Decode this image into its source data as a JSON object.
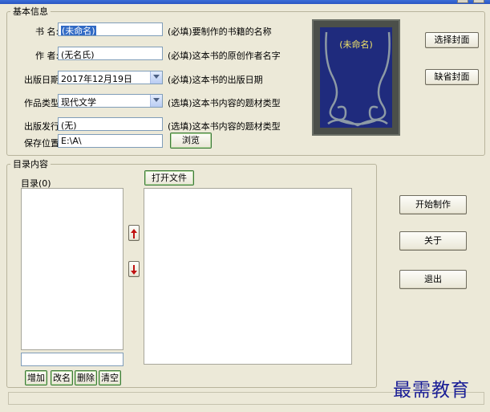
{
  "basic": {
    "group_title": "基本信息",
    "book_name_label": "书  名:",
    "book_name_value": "(未命名)",
    "book_name_hint": "(必填)要制作的书籍的名称",
    "author_label": "作  者:",
    "author_value": "(无名氏)",
    "author_hint": "(必填)这本书的原创作者名字",
    "date_label": "出版日期:",
    "date_value": "2017年12月19日",
    "date_hint": "(必填)这本书的出版日期",
    "genre_label": "作品类型:",
    "genre_value": "现代文学",
    "genre_hint": "(选填)这本书内容的题材类型",
    "publisher_label": "出版发行:",
    "publisher_value": "(无)",
    "publisher_hint": "(选填)这本书内容的题材类型",
    "save_label": "保存位置:",
    "save_value": "E:\\A\\",
    "browse_button": "浏览",
    "cover_title": "(未命名)",
    "choose_cover_button": "选择封面",
    "default_cover_button": "缺省封面"
  },
  "toc": {
    "group_title": "目录内容",
    "list_label": "目录(0)",
    "open_file_button": "打开文件",
    "add_button": "增加",
    "rename_button": "改名",
    "delete_button": "删除",
    "clear_button": "清空"
  },
  "actions": {
    "start_button": "开始制作",
    "about_button": "关于",
    "exit_button": "退出"
  },
  "watermark": "最需教育",
  "colors": {
    "window_bg": "#ece9d8",
    "cover_bg": "#1f2b7d",
    "cover_title": "#f2e468",
    "selection": "#316ac5",
    "arrow_red": "#c01010",
    "watermark": "#1a1e96"
  }
}
